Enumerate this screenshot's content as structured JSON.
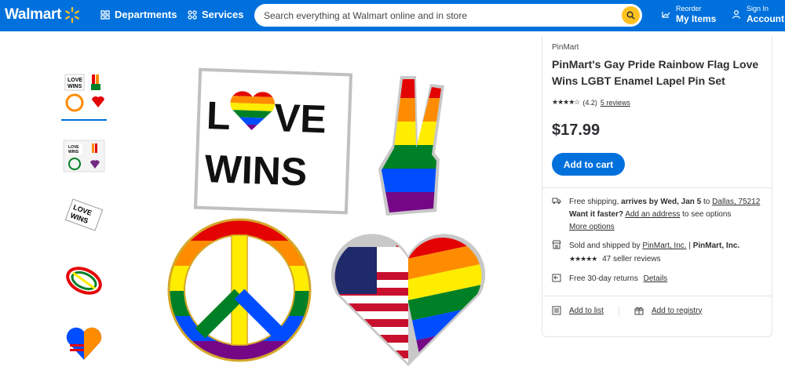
{
  "header": {
    "logo_text": "Walmart",
    "departments": "Departments",
    "services": "Services",
    "search_placeholder": "Search everything at Walmart online and in store",
    "reorder_small": "Reorder",
    "reorder_big": "My Items",
    "account_small": "Sign In",
    "account_big": "Account"
  },
  "colors": {
    "brand_blue": "#0071dc",
    "spark_yellow": "#ffc220"
  },
  "icons": [
    "spark-logo-icon",
    "grid-icon",
    "search-icon",
    "heart-icon",
    "user-icon",
    "truck-icon",
    "store-icon",
    "return-icon",
    "list-icon",
    "gift-icon"
  ],
  "thumbnails": [
    "thumbnail-1",
    "thumbnail-2",
    "thumbnail-3",
    "thumbnail-4",
    "thumbnail-5"
  ],
  "main_image": {
    "top_left_word1_a": "L",
    "top_left_word1_b": "VE",
    "top_left_word2": "WINS"
  },
  "product": {
    "seller_name": "PinMart",
    "title": "PinMart's Gay Pride Rainbow Flag Love Wins LGBT Enamel Lapel Pin Set",
    "rating_stars": 4.2,
    "rating_text": "(4.2)",
    "reviews_link": "5 reviews",
    "price": "$17.99",
    "add_to_cart": "Add to cart"
  },
  "shipping": {
    "free_shipping": "Free shipping, ",
    "arrives": "arrives by Wed, Jan 5",
    "to": " to ",
    "location": "Dallas, 75212",
    "want_faster": "Want it faster?",
    "add_address": "Add an address",
    "see_options": " to see options",
    "more_options": "More options"
  },
  "seller": {
    "sold_shipped": "Sold and shipped by ",
    "seller_link": "PinMart, Inc.",
    "separator": " | ",
    "seller_bold": "PinMart, Inc.",
    "seller_stars": 4.5,
    "seller_reviews": "47 seller reviews"
  },
  "returns": {
    "text": "Free 30-day returns",
    "details": "Details"
  },
  "actions": {
    "add_to_list": "Add to list",
    "add_to_registry": "Add to registry"
  }
}
